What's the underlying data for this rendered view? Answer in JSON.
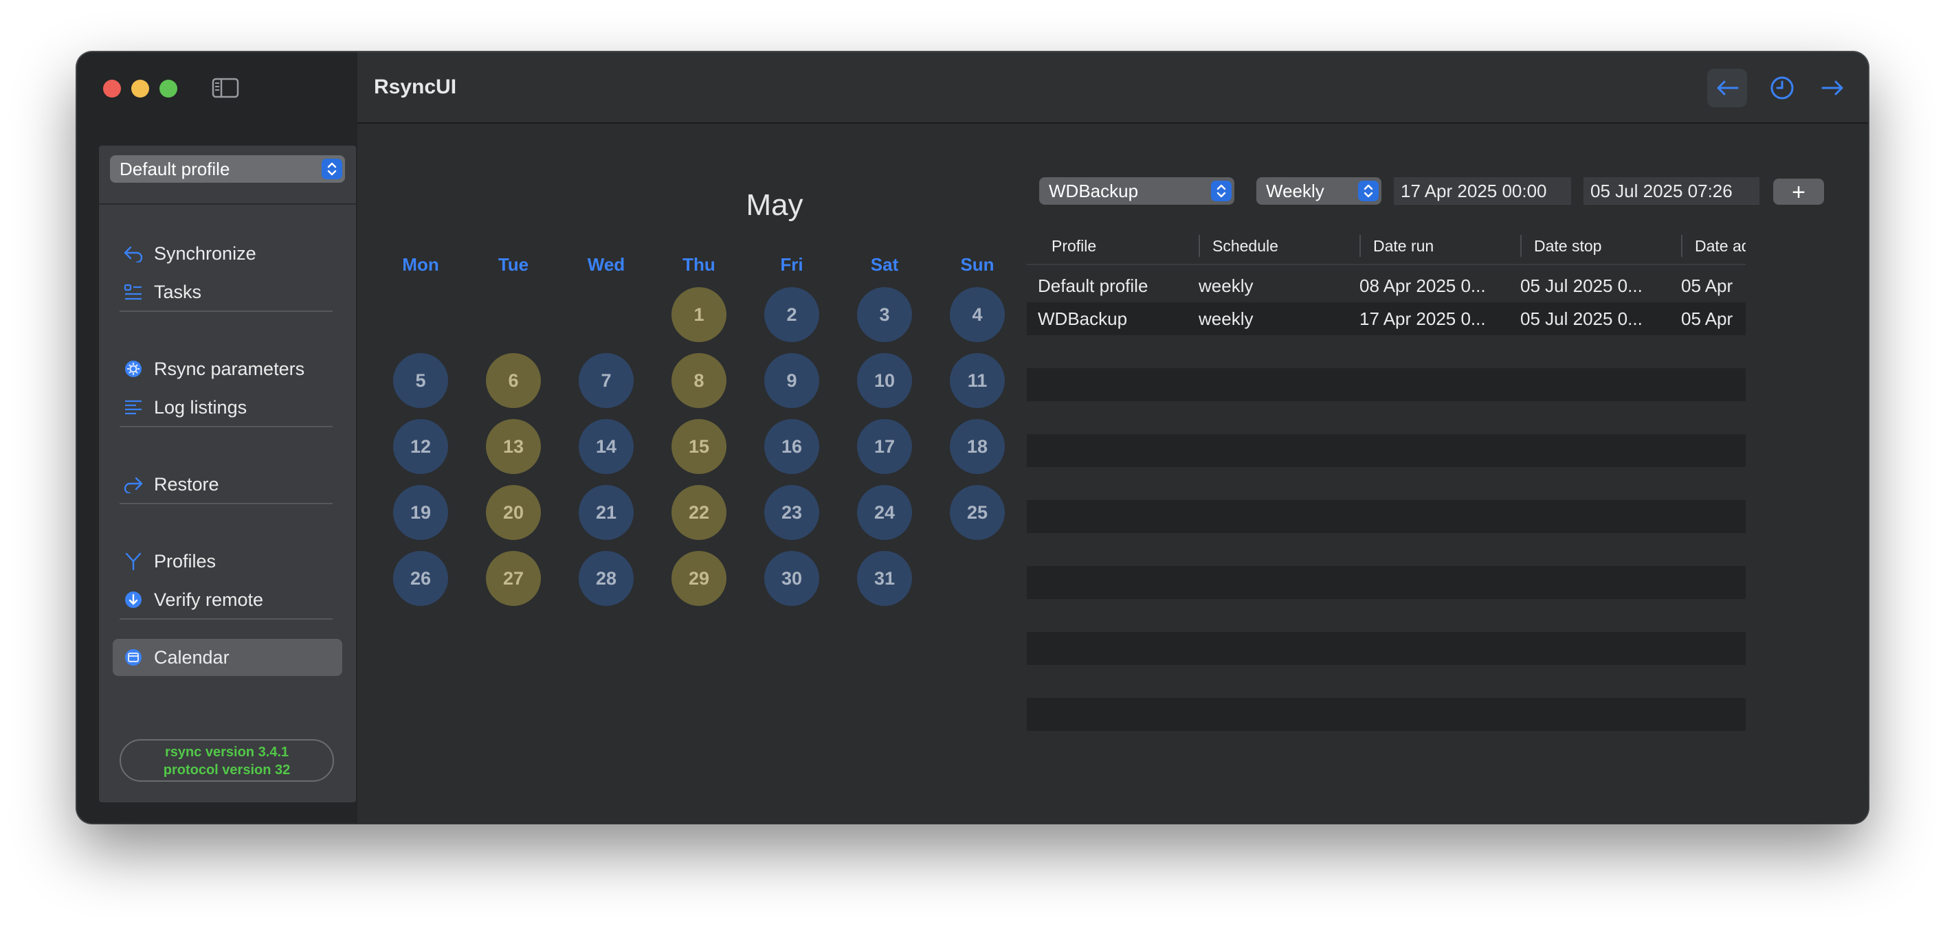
{
  "app": {
    "title": "RsyncUI"
  },
  "sidebar": {
    "profile_select": "Default profile",
    "items": [
      {
        "label": "Synchronize"
      },
      {
        "label": "Tasks"
      },
      {
        "label": "Rsync parameters"
      },
      {
        "label": "Log listings"
      },
      {
        "label": "Restore"
      },
      {
        "label": "Profiles"
      },
      {
        "label": "Verify remote"
      },
      {
        "label": "Calendar"
      }
    ],
    "active_item": "Calendar",
    "version_line1": "rsync  version 3.4.1",
    "version_line2": "protocol version 32"
  },
  "calendar": {
    "month": "May",
    "weekdays": [
      "Mon",
      "Tue",
      "Wed",
      "Thu",
      "Fri",
      "Sat",
      "Sun"
    ],
    "first_weekday_index": 3,
    "days": [
      {
        "d": "1",
        "c": "olive"
      },
      {
        "d": "2",
        "c": "blue"
      },
      {
        "d": "3",
        "c": "blue"
      },
      {
        "d": "4",
        "c": "blue"
      },
      {
        "d": "5",
        "c": "blue"
      },
      {
        "d": "6",
        "c": "olive"
      },
      {
        "d": "7",
        "c": "blue"
      },
      {
        "d": "8",
        "c": "olive"
      },
      {
        "d": "9",
        "c": "blue"
      },
      {
        "d": "10",
        "c": "blue"
      },
      {
        "d": "11",
        "c": "blue"
      },
      {
        "d": "12",
        "c": "blue"
      },
      {
        "d": "13",
        "c": "olive"
      },
      {
        "d": "14",
        "c": "blue"
      },
      {
        "d": "15",
        "c": "olive"
      },
      {
        "d": "16",
        "c": "blue"
      },
      {
        "d": "17",
        "c": "blue"
      },
      {
        "d": "18",
        "c": "blue"
      },
      {
        "d": "19",
        "c": "blue"
      },
      {
        "d": "20",
        "c": "olive"
      },
      {
        "d": "21",
        "c": "blue"
      },
      {
        "d": "22",
        "c": "olive"
      },
      {
        "d": "23",
        "c": "blue"
      },
      {
        "d": "24",
        "c": "blue"
      },
      {
        "d": "25",
        "c": "blue"
      },
      {
        "d": "26",
        "c": "blue"
      },
      {
        "d": "27",
        "c": "olive"
      },
      {
        "d": "28",
        "c": "blue"
      },
      {
        "d": "29",
        "c": "olive"
      },
      {
        "d": "30",
        "c": "blue"
      },
      {
        "d": "31",
        "c": "blue"
      }
    ]
  },
  "controls": {
    "profile": "WDBackup",
    "schedule": "Weekly",
    "date_run": "17 Apr 2025 00:00",
    "date_stop": "05 Jul 2025 07:26",
    "add_label": "+"
  },
  "table": {
    "headers": [
      "Profile",
      "Schedule",
      "Date run",
      "Date stop",
      "Date ad"
    ],
    "rows": [
      [
        "Default profile",
        "weekly",
        "08 Apr 2025 0...",
        "05 Jul 2025 0...",
        "05 Apr"
      ],
      [
        "WDBackup",
        "weekly",
        "17 Apr 2025 0...",
        "05 Jul 2025 0...",
        "05 Apr"
      ]
    ]
  },
  "colors": {
    "accent": "#3b82f6",
    "day_scheduled": "#6b6438",
    "day_normal": "#2f4566",
    "version_text": "#52c848"
  }
}
